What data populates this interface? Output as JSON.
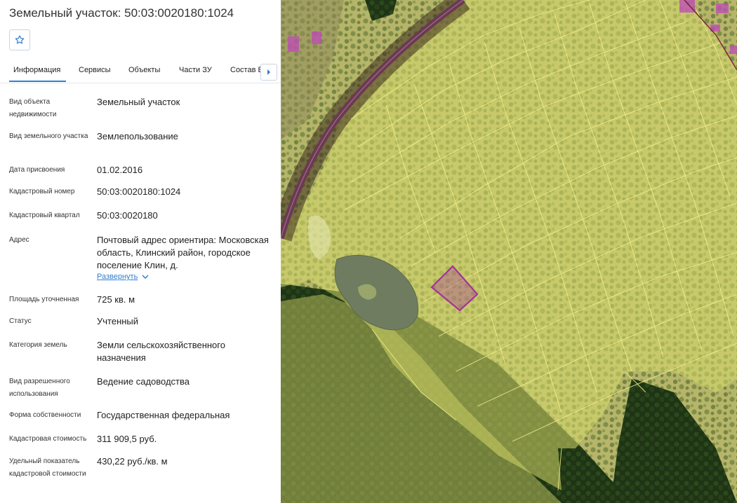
{
  "panel": {
    "title": "Земельный участок: 50:03:0020180:1024",
    "favorite_icon": "star-outline-icon",
    "tabs": [
      {
        "label": "Информация",
        "active": true
      },
      {
        "label": "Сервисы",
        "active": false
      },
      {
        "label": "Объекты",
        "active": false
      },
      {
        "label": "Части ЗУ",
        "active": false
      },
      {
        "label": "Состав Е",
        "active": false
      }
    ],
    "tabs_next_icon": "caret-right-icon",
    "properties": [
      {
        "label": "Вид объекта недвижимости",
        "value": "Земельный участок"
      },
      {
        "label": "Вид земельного участка",
        "value": "Землепользование"
      },
      {
        "label": "Дата присвоения",
        "value": "01.02.2016"
      },
      {
        "label": "Кадастровый номер",
        "value": "50:03:0020180:1024"
      },
      {
        "label": "Кадастровый квартал",
        "value": "50:03:0020180"
      },
      {
        "label": "Адрес",
        "value": "Почтовый адрес ориентира: Московская область, Клинский район, городское поселение Клин, д."
      },
      {
        "label": "Площадь уточненная",
        "value": "725 кв. м"
      },
      {
        "label": "Статус",
        "value": "Учтенный"
      },
      {
        "label": "Категория земель",
        "value": "Земли сельскохозяйственного назначения"
      },
      {
        "label": "Вид разрешенного использования",
        "value": "Ведение садоводства"
      },
      {
        "label": "Форма собственности",
        "value": "Государственная федеральная"
      },
      {
        "label": "Кадастровая стоимость",
        "value": "311 909,5 руб."
      },
      {
        "label": "Удельный показатель кадастровой стоимости",
        "value": "430,22 руб./кв. м"
      }
    ],
    "address_expand": {
      "label": "Развернуть",
      "icon": "chevron-down-icon"
    }
  },
  "map": {
    "overlay_color": "#d6d96a",
    "parcel_border_color": "#f3f08a",
    "selected_parcel_color": "#a4329a",
    "road_color": "#6a3a52"
  }
}
